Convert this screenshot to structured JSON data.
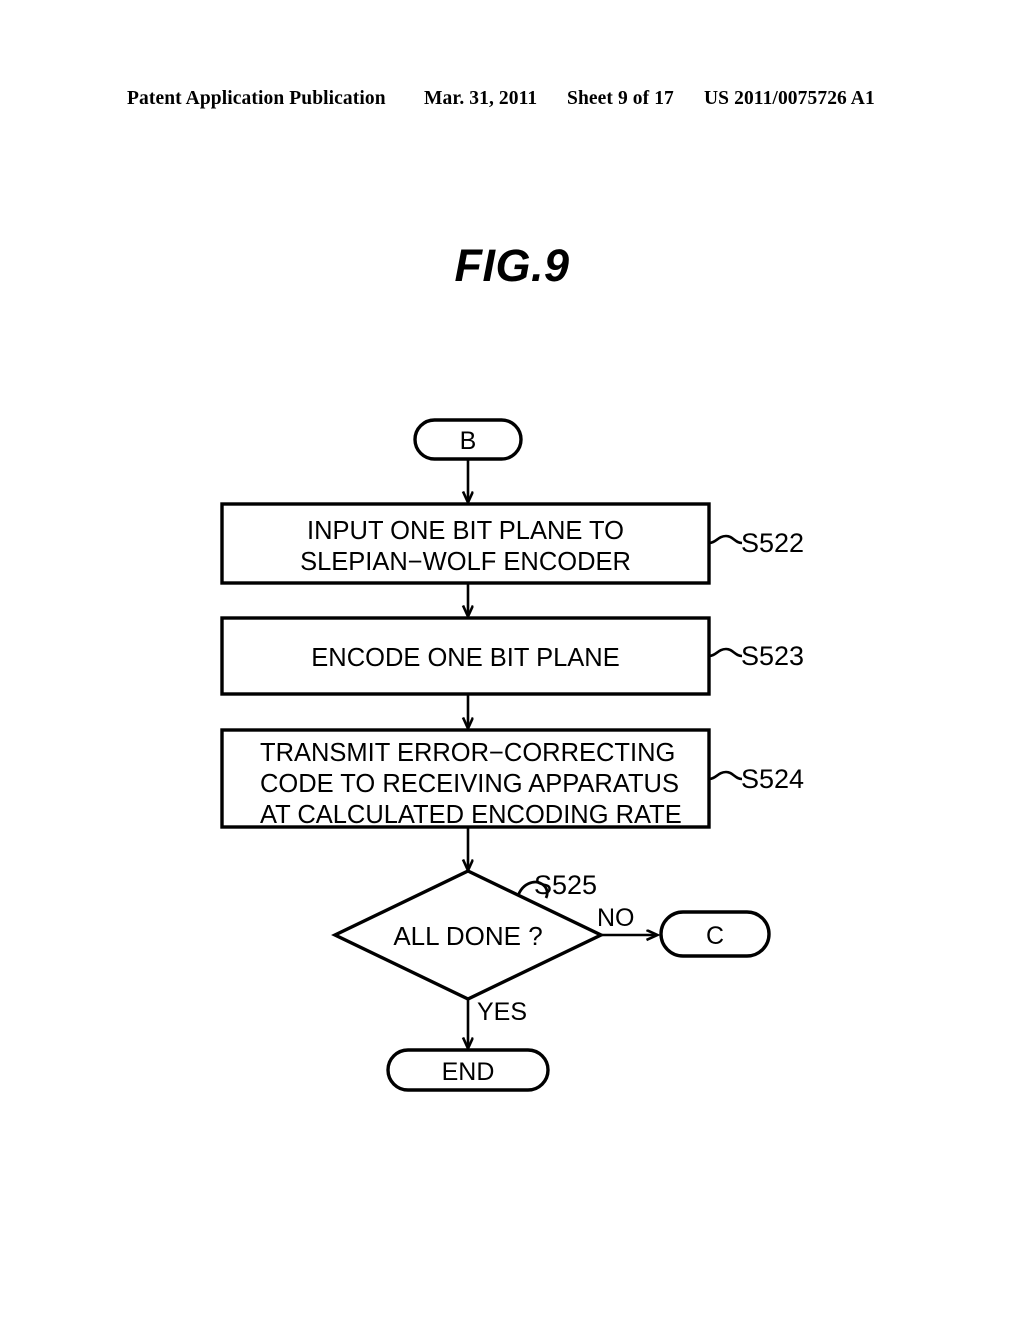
{
  "header": {
    "publication": "Patent Application Publication",
    "date": "Mar. 31, 2011",
    "sheet": "Sheet 9 of 17",
    "document_number": "US 2011/0075726 A1"
  },
  "figure": {
    "title": "FIG.9"
  },
  "flowchart": {
    "start_connector": {
      "label": "B",
      "shape": "stadium"
    },
    "steps": [
      {
        "id": "s522",
        "step_number": "S522",
        "shape": "process",
        "lines": [
          "INPUT ONE BIT PLANE TO",
          "SLEPIAN−WOLF ENCODER"
        ],
        "align": "center"
      },
      {
        "id": "s523",
        "step_number": "S523",
        "shape": "process",
        "lines": [
          "ENCODE ONE BIT PLANE"
        ],
        "align": "center"
      },
      {
        "id": "s524",
        "step_number": "S524",
        "shape": "process",
        "lines": [
          "TRANSMIT ERROR−CORRECTING",
          "CODE TO RECEIVING APPARATUS",
          "AT CALCULATED ENCODING RATE"
        ],
        "align": "left"
      },
      {
        "id": "s525",
        "step_number": "S525",
        "shape": "decision",
        "lines": [
          "ALL DONE ?"
        ],
        "align": "center"
      }
    ],
    "branches": {
      "no_label": "NO",
      "yes_label": "YES"
    },
    "no_connector": {
      "label": "C",
      "shape": "stadium"
    },
    "end_terminal": {
      "label": "END",
      "shape": "stadium"
    },
    "colors": {
      "line": "#000000",
      "fill": "#ffffff"
    }
  }
}
